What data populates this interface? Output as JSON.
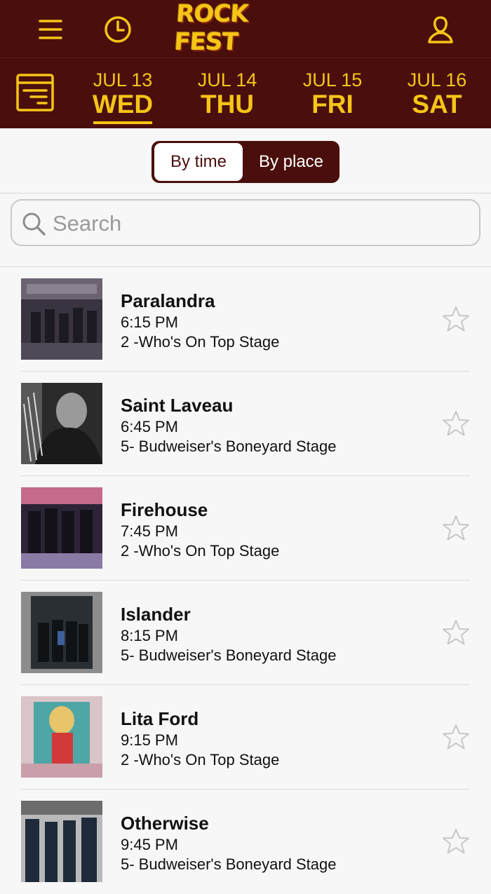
{
  "header": {
    "logo_text": "ROCK FEST",
    "menu_icon": "hamburger-icon",
    "history_icon": "clock-icon",
    "profile_icon": "user-icon",
    "accent_color": "#f5c518",
    "bar_color": "#4a0f0c"
  },
  "dates": [
    {
      "month_day": "JUL 13",
      "weekday": "WED",
      "selected": true
    },
    {
      "month_day": "JUL 14",
      "weekday": "THU",
      "selected": false
    },
    {
      "month_day": "JUL 15",
      "weekday": "FRI",
      "selected": false
    },
    {
      "month_day": "JUL 16",
      "weekday": "SAT",
      "selected": false
    }
  ],
  "view_toggle": {
    "by_time": "By time",
    "by_place": "By place",
    "selected": "By time"
  },
  "search": {
    "placeholder": "Search",
    "value": ""
  },
  "performances": [
    {
      "name": "Paralandra",
      "time": "6:15 PM",
      "stage": "2 -Who's On Top Stage",
      "favorite": false
    },
    {
      "name": "Saint Laveau",
      "time": "6:45 PM",
      "stage": "5- Budweiser's Boneyard Stage",
      "favorite": false
    },
    {
      "name": "Firehouse",
      "time": "7:45 PM",
      "stage": "2 -Who's On Top Stage",
      "favorite": false
    },
    {
      "name": "Islander",
      "time": "8:15 PM",
      "stage": "5- Budweiser's Boneyard Stage",
      "favorite": false
    },
    {
      "name": "Lita Ford",
      "time": "9:15 PM",
      "stage": "2 -Who's On Top Stage",
      "favorite": false
    },
    {
      "name": "Otherwise",
      "time": "9:45 PM",
      "stage": "5- Budweiser's Boneyard Stage",
      "favorite": false
    }
  ]
}
